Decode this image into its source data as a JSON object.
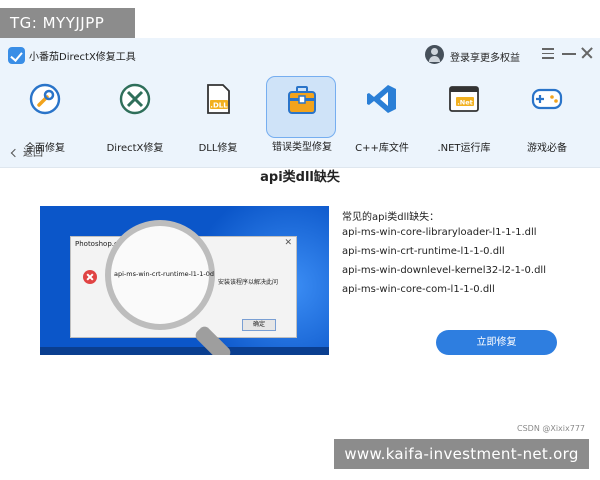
{
  "overlay": {
    "tag": "TG: MYYJJPP",
    "watermark": "www.kaifa-investment-net.org",
    "credit": "CSDN @Xixix777"
  },
  "titlebar": {
    "app_title": "小番茄DirectX修复工具",
    "login_label": "登录享更多权益"
  },
  "toolbar": {
    "active_index": 3,
    "items": [
      {
        "label": "全面修复",
        "icon": "wrench-icon"
      },
      {
        "label": "DirectX修复",
        "icon": "directx-icon"
      },
      {
        "label": "DLL修复",
        "icon": "dll-file-icon"
      },
      {
        "label": "错误类型修复",
        "icon": "toolbox-icon"
      },
      {
        "label": "C++库文件",
        "icon": "visual-studio-icon"
      },
      {
        "label": ".NET运行库",
        "icon": "dotnet-icon"
      },
      {
        "label": "游戏必备",
        "icon": "gamepad-icon"
      }
    ]
  },
  "main": {
    "back_label": "返回",
    "title": "api类dll缺失",
    "illustration": {
      "dialog_title": "Photoshop.e",
      "dialog_close": "✕",
      "magnified_text": "api-ms-win-crt-runtime-l1-1-0d",
      "message": "安装该程序以解决此问",
      "ok_label": "确定"
    },
    "list_heading": "常见的api类dll缺失：",
    "dll_list": [
      "api-ms-win-core-libraryloader-l1-1-1.dll",
      "api-ms-win-crt-runtime-l1-1-0.dll",
      "api-ms-win-downlevel-kernel32-l2-1-0.dll",
      "api-ms-win-core-com-l1-1-0.dll"
    ],
    "repair_button": "立即修复"
  },
  "colors": {
    "accent": "#2e7ee0",
    "toolbar_bg": "#ecf4fc",
    "active_tab_bg": "#cfe3f8",
    "illustration_bg": "#0b56c9"
  }
}
